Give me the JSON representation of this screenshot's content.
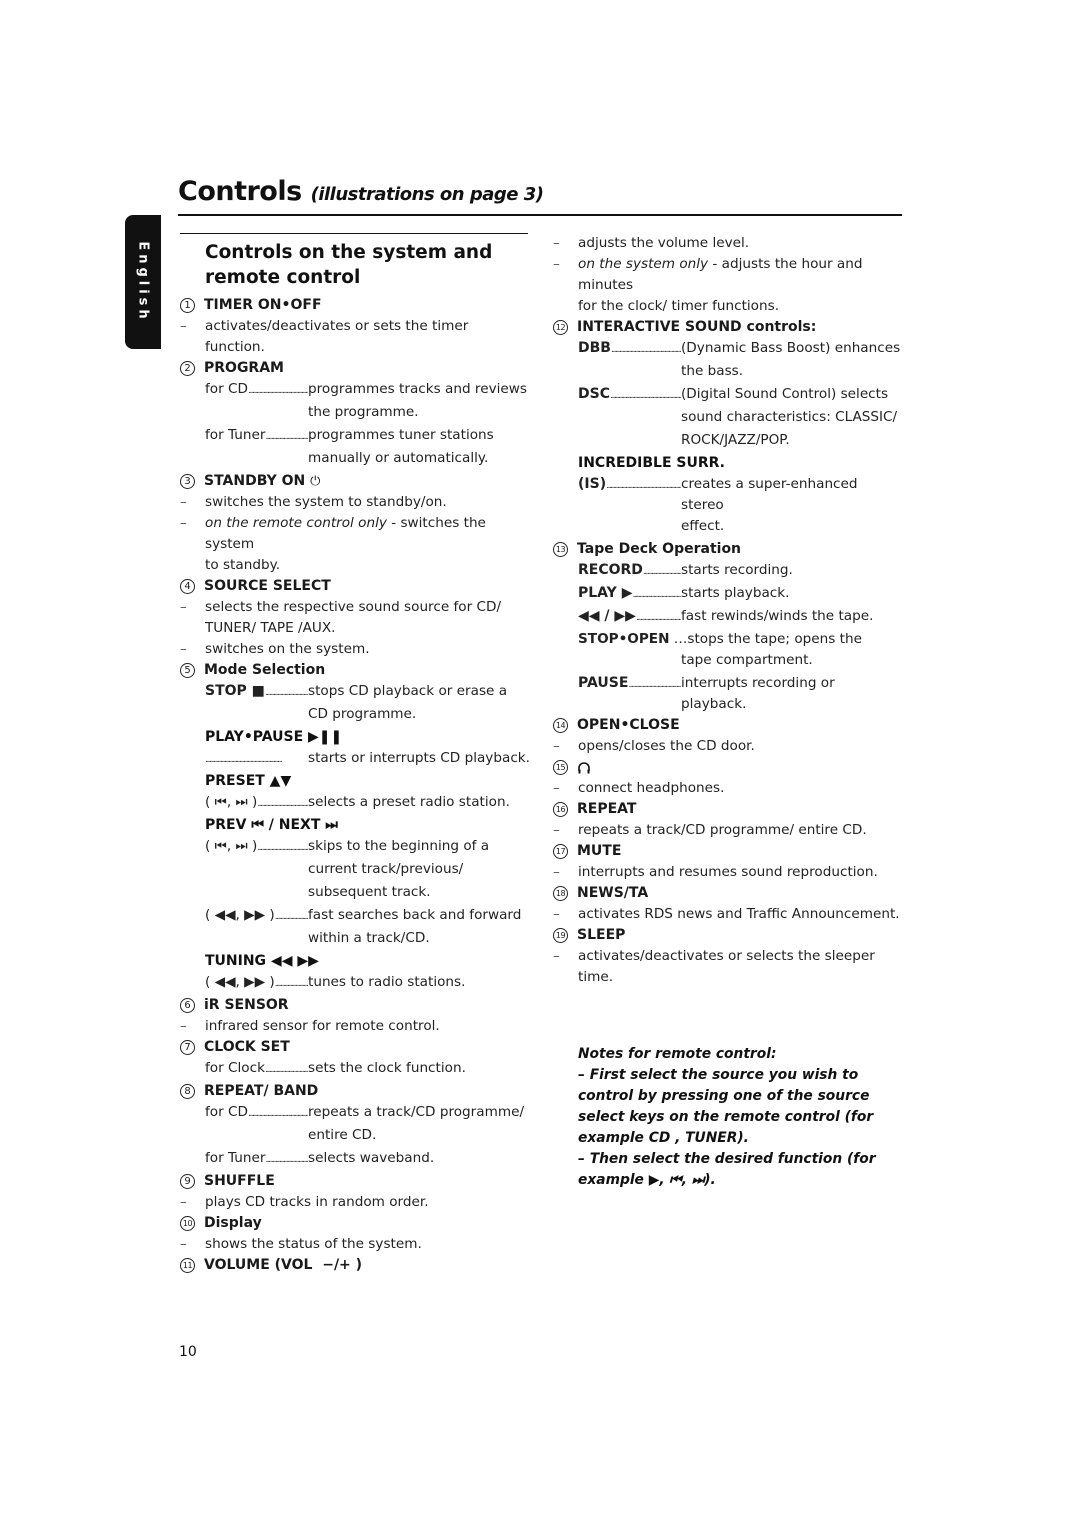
{
  "page": {
    "title": "Controls",
    "title_sub": "(illustrations on page 3)",
    "language_tab": "English",
    "page_number": "10"
  },
  "section": {
    "title_line1": "Controls on the system and",
    "title_line2": "remote control"
  },
  "items": {
    "i1": {
      "num": "1",
      "title": "TIMER ON•OFF",
      "desc": "activates/deactivates or sets the timer function."
    },
    "i2": {
      "num": "2",
      "title": "PROGRAM",
      "rows": [
        {
          "key": "for CD",
          "val1": "programmes tracks and reviews",
          "val2": "the programme."
        },
        {
          "key": "for Tuner",
          "val1": "programmes tuner stations",
          "val2": "manually or automatically."
        }
      ]
    },
    "i3": {
      "num": "3",
      "title": "STANDBY ON",
      "icon": "⏻",
      "desc1": "switches the system to standby/on.",
      "desc2_italic": "on the remote control only",
      "desc2_rest": " - switches the system",
      "desc2_cont": "to standby."
    },
    "i4": {
      "num": "4",
      "title": "SOURCE SELECT",
      "desc1": "selects the respective sound source for CD/",
      "desc1_cont": "TUNER/ TAPE /AUX.",
      "desc2": "switches on the system."
    },
    "i5": {
      "num": "5",
      "title": "Mode Selection",
      "stop_key": "STOP ■",
      "stop_val1": "stops CD playback or erase a",
      "stop_val2": "CD programme.",
      "playpause_head": "PLAY•PAUSE ▶❚❚",
      "playpause_val": "starts or interrupts CD playback.",
      "preset_head": "PRESET ▲▼",
      "preset_key": "( ⏮, ⏭ )",
      "preset_val": "selects a preset radio station.",
      "prevnext_head": "PREV ⏮ / NEXT ⏭",
      "prevnext_key1": "( ⏮, ⏭ )",
      "prevnext_val1a": "skips to the beginning of a",
      "prevnext_val1b": "current track/previous/",
      "prevnext_val1c": "subsequent track.",
      "prevnext_key2": "( ◀◀, ▶▶ )",
      "prevnext_val2a": "fast searches back and forward",
      "prevnext_val2b": "within a track/CD.",
      "tuning_head": "TUNING ◀◀ ▶▶",
      "tuning_key": "( ◀◀, ▶▶ )",
      "tuning_val": "tunes to radio stations."
    },
    "i6": {
      "num": "6",
      "title": "iR SENSOR",
      "desc": "infrared sensor for remote control."
    },
    "i7": {
      "num": "7",
      "title": "CLOCK SET",
      "key": "for Clock",
      "val": "sets the clock function."
    },
    "i8": {
      "num": "8",
      "title": "REPEAT/ BAND",
      "rows": [
        {
          "key": "for CD",
          "val1": "repeats a track/CD programme/",
          "val2": "entire CD."
        },
        {
          "key": "for Tuner",
          "val1": "selects waveband."
        }
      ]
    },
    "i9": {
      "num": "9",
      "title": "SHUFFLE",
      "desc": "plays CD tracks in random order."
    },
    "i10": {
      "num": "10",
      "title": "Display",
      "desc": "shows the status of the system."
    },
    "i11": {
      "num": "11",
      "title": "VOLUME (VOL  −/+ )",
      "desc1": "adjusts the volume level.",
      "desc2_italic": "on the system only",
      "desc2_rest": " - adjusts the hour and minutes",
      "desc2_cont": "for the clock/ timer functions."
    },
    "i12": {
      "num": "12",
      "title": "INTERACTIVE SOUND controls:",
      "dbb_key": "DBB",
      "dbb_val1": "(Dynamic Bass Boost) enhances",
      "dbb_val2": "the bass.",
      "dsc_key": "DSC",
      "dsc_val1": "(Digital Sound Control) selects",
      "dsc_val2": "sound characteristics: CLASSIC/",
      "dsc_val3": "ROCK/JAZZ/POP.",
      "is_head": "INCREDIBLE SURR.",
      "is_key": "(IS)",
      "is_val1": "creates a super-enhanced stereo",
      "is_val2": "effect."
    },
    "i13": {
      "num": "13",
      "title": "Tape Deck Operation",
      "record_key": "RECORD",
      "record_val": "starts recording.",
      "play_key": "PLAY ▶",
      "play_val": "starts playback.",
      "ff_key": "◀◀ / ▶▶",
      "ff_val": "fast rewinds/winds the tape.",
      "stopopen_key": "STOP•OPEN",
      "stopopen_val1": "…stops the tape; opens the",
      "stopopen_val2": "tape compartment.",
      "pause_key": "PAUSE",
      "pause_val": "interrupts recording or playback."
    },
    "i14": {
      "num": "14",
      "title": "OPEN•CLOSE",
      "desc": "opens/closes the CD door."
    },
    "i15": {
      "num": "15",
      "icon": "headphones",
      "desc": "connect headphones."
    },
    "i16": {
      "num": "16",
      "title": "REPEAT",
      "desc": "repeats a track/CD programme/ entire CD."
    },
    "i17": {
      "num": "17",
      "title": "MUTE",
      "desc": "interrupts and resumes sound reproduction."
    },
    "i18": {
      "num": "18",
      "title": "NEWS/TA",
      "desc": "activates RDS news and Traffic Announcement."
    },
    "i19": {
      "num": "19",
      "title": "SLEEP",
      "desc": "activates/deactivates or selects the sleeper time."
    }
  },
  "dash": "–",
  "notes": {
    "title": "Notes for remote control:",
    "line1": "–  First select the source you wish to control by pressing one of the source select keys on the remote control (for example CD , TUNER).",
    "line2": "–  Then select the desired function (for example ▶,  ⏮,  ⏭)."
  }
}
